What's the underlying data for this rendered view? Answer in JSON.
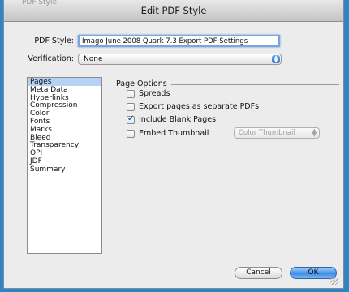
{
  "window": {
    "title": "Edit PDF Style",
    "ghost_title": "PDF Style"
  },
  "form": {
    "pdf_style_label": "PDF Style:",
    "pdf_style_value": "Imago June 2008 Quark 7.3 Export PDF Settings",
    "verification_label": "Verification:",
    "verification_value": "None"
  },
  "sidebar": {
    "items": [
      {
        "label": "Pages",
        "selected": true
      },
      {
        "label": "Meta Data"
      },
      {
        "label": "Hyperlinks"
      },
      {
        "label": "Compression"
      },
      {
        "label": "Color"
      },
      {
        "label": "Fonts"
      },
      {
        "label": "Marks"
      },
      {
        "label": "Bleed"
      },
      {
        "label": "Transparency"
      },
      {
        "label": "OPI"
      },
      {
        "label": "JDF"
      },
      {
        "label": "Summary"
      }
    ]
  },
  "page_options": {
    "title": "Page Options",
    "spreads": {
      "label": "Spreads",
      "checked": false
    },
    "separate_pdfs": {
      "label": "Export pages as separate PDFs",
      "checked": false
    },
    "include_blank": {
      "label": "Include Blank Pages",
      "checked": true
    },
    "embed_thumbnail": {
      "label": "Embed Thumbnail",
      "checked": false,
      "select_value": "Color Thumbnail",
      "select_enabled": false
    }
  },
  "buttons": {
    "cancel": "Cancel",
    "ok": "OK"
  },
  "colors": {
    "background_accent": "#2a86c7",
    "default_button": "#3d8ce6",
    "selection": "#b5d2f3"
  }
}
